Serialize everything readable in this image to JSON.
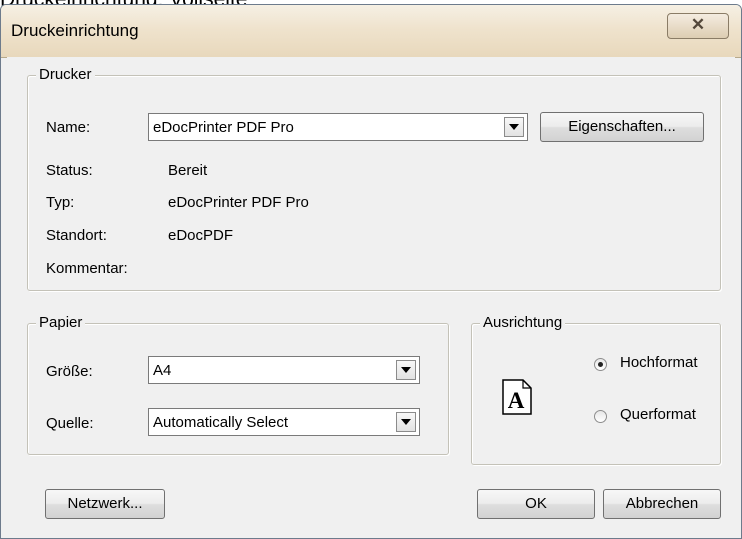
{
  "cutoff_text": "Druckeinrichtung: Vollseite",
  "window": {
    "title": "Druckeinrichtung"
  },
  "printer": {
    "legend": "Drucker",
    "name_label": "Name:",
    "name_value": "eDocPrinter PDF Pro",
    "properties_button": "Eigenschaften...",
    "status_label": "Status:",
    "status_value": "Bereit",
    "type_label": "Typ:",
    "type_value": "eDocPrinter PDF Pro",
    "location_label": "Standort:",
    "location_value": "eDocPDF",
    "comment_label": "Kommentar:",
    "comment_value": ""
  },
  "paper": {
    "legend": "Papier",
    "size_label": "Größe:",
    "size_value": "A4",
    "source_label": "Quelle:",
    "source_value": "Automatically Select"
  },
  "orientation": {
    "legend": "Ausrichtung",
    "icon_letter": "A",
    "portrait_label": "Hochformat",
    "landscape_label": "Querformat",
    "selected": "portrait"
  },
  "buttons": {
    "network": "Netzwerk...",
    "ok": "OK",
    "cancel": "Abbrechen"
  }
}
